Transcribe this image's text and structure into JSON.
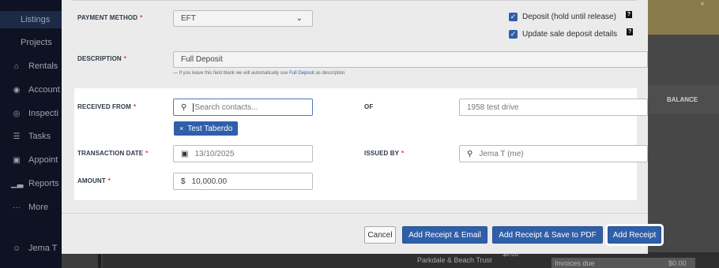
{
  "sidebar": {
    "items": [
      {
        "label": "Listings",
        "icon": ""
      },
      {
        "label": "Projects",
        "icon": ""
      },
      {
        "label": "Rentals",
        "icon": "home-icon"
      },
      {
        "label": "Account",
        "icon": "dollar-icon"
      },
      {
        "label": "Inspecti",
        "icon": "eye-icon"
      },
      {
        "label": "Tasks",
        "icon": "tasks-icon"
      },
      {
        "label": "Appoint",
        "icon": "calendar-icon"
      },
      {
        "label": "Reports",
        "icon": "bar-chart-icon"
      },
      {
        "label": "More",
        "icon": "more-icon"
      }
    ],
    "user": "Jema T"
  },
  "background": {
    "balance_header": "BALANCE",
    "trust_label": "Parkdale & Beach Trust",
    "trust_value": "$0.00",
    "invoices_label": "Invoices due",
    "invoices_value": "$0.00",
    "banner_close": "×"
  },
  "form": {
    "payment_method": {
      "label": "PAYMENT METHOD",
      "value": "EFT"
    },
    "deposit_hold": {
      "label": "Deposit (hold until release)",
      "checked": true
    },
    "update_sale": {
      "label": "Update sale deposit details",
      "checked": true
    },
    "description": {
      "label": "DESCRIPTION",
      "value": "Full Deposit"
    },
    "hint": {
      "prefix": "— If you leave this field blank we will automatically use",
      "link": "Full Deposit",
      "suffix": "as description"
    },
    "received_from": {
      "label": "RECEIVED FROM",
      "placeholder": "Search contacts...",
      "chip": "Test Taberdo"
    },
    "of": {
      "label": "OF",
      "value": "1958 test drive"
    },
    "transaction_date": {
      "label": "TRANSACTION DATE",
      "value": "13/10/2025"
    },
    "issued_by": {
      "label": "ISSUED BY",
      "value": "Jema T (me)"
    },
    "amount": {
      "label": "AMOUNT",
      "currency": "$",
      "value": "10,000.00"
    },
    "required_mark": "*",
    "help_mark": "?"
  },
  "footer": {
    "cancel": "Cancel",
    "add_email": "Add Receipt & Email",
    "add_pdf": "Add Receipt & Save to PDF",
    "add": "Add Receipt"
  },
  "colors": {
    "accent": "#2f5fa8",
    "required": "#e03a3a",
    "sidebar_bg": "#0d1322"
  }
}
